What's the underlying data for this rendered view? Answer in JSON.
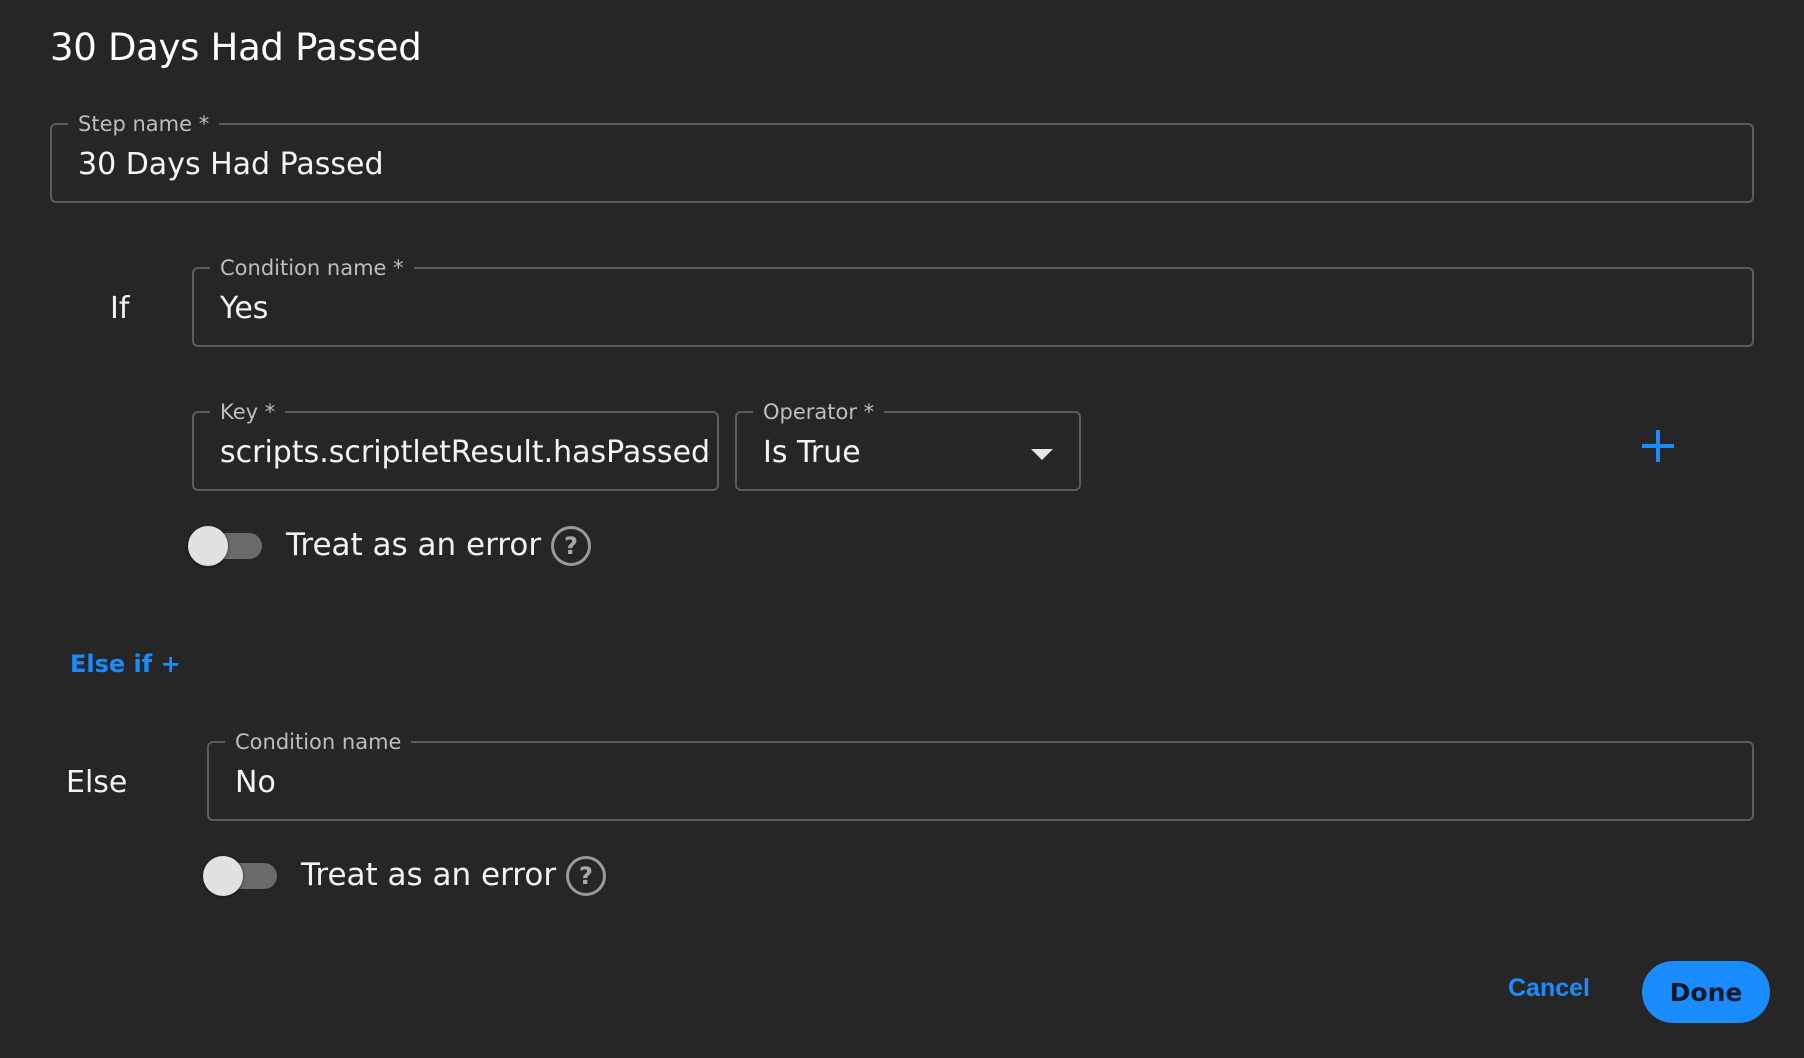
{
  "dialog": {
    "title": "30 Days Had Passed"
  },
  "step": {
    "label": "Step name *",
    "value": "30 Days Had Passed"
  },
  "if_block": {
    "label": "If",
    "condition_name_label": "Condition name *",
    "condition_name_value": "Yes",
    "key_label": "Key *",
    "key_value": "scripts.scriptletResult.hasPassed",
    "operator_label": "Operator *",
    "operator_value": "Is True",
    "add_icon": "plus-icon",
    "treat_as_error_label": "Treat as an error",
    "treat_as_error_on": false,
    "help_icon": "question-circle-icon",
    "help_glyph": "?"
  },
  "else_if": {
    "label": "Else if +"
  },
  "else_block": {
    "label": "Else",
    "condition_name_label": "Condition name",
    "condition_name_value": "No",
    "treat_as_error_label": "Treat as an error",
    "treat_as_error_on": false,
    "help_icon": "question-circle-icon",
    "help_glyph": "?"
  },
  "actions": {
    "cancel_label": "Cancel",
    "done_label": "Done"
  },
  "colors": {
    "background": "#262626",
    "accent": "#1a8cff",
    "border": "#5c5c5c"
  }
}
